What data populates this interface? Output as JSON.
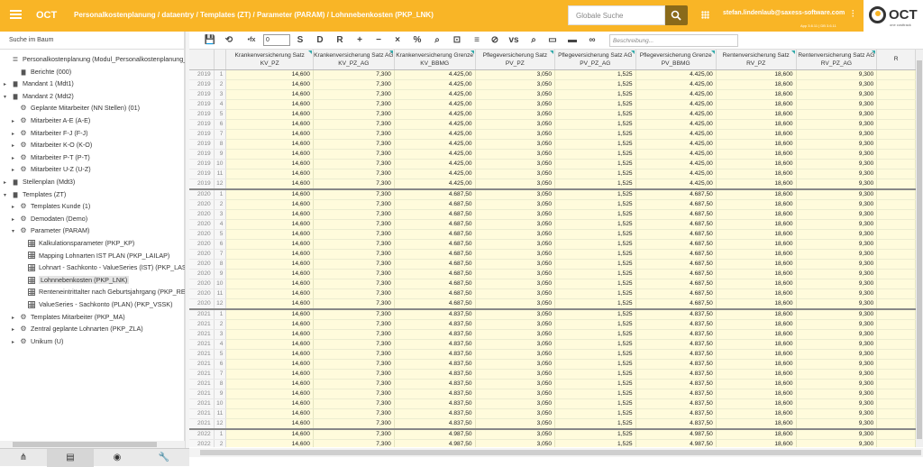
{
  "header": {
    "app_title": "OCT",
    "breadcrumb": "Personalkostenplanung / dataentry / Templates (ZT) / Parameter (PARAM) / Lohnnebenkosten (PKP_LNK)",
    "search_placeholder": "Globale Suche",
    "user": "stefan.lindenlaub@saxess-software.com",
    "version": "App 3.6.11 | DB 3.6.11",
    "logo_text": "OCT",
    "logo_sub": "one costtrack",
    "accent": "#f9b526"
  },
  "sidebar": {
    "search_label": "Suche im Baum",
    "items": [
      {
        "label": "Personalkostenplanung (Modul_Personalkostenplanung_De",
        "indent": 0,
        "arrow": "",
        "icon": "db"
      },
      {
        "label": "Berichte (000)",
        "indent": 1,
        "arrow": "",
        "icon": "folder"
      },
      {
        "label": "Mandant 1 (Mdt1)",
        "indent": 0,
        "arrow": "▸",
        "icon": "folder"
      },
      {
        "label": "Mandant 2 (Mdt2)",
        "indent": 0,
        "arrow": "▾",
        "icon": "folder"
      },
      {
        "label": "Geplante Mitarbeiter (NN Stellen) (01)",
        "indent": 1,
        "arrow": "",
        "icon": "gear"
      },
      {
        "label": "Mitarbeiter A-E (A-E)",
        "indent": 1,
        "arrow": "▸",
        "icon": "gear"
      },
      {
        "label": "Mitarbeiter F-J (F-J)",
        "indent": 1,
        "arrow": "▸",
        "icon": "gear"
      },
      {
        "label": "Mitarbeiter K-O (K-O)",
        "indent": 1,
        "arrow": "▸",
        "icon": "gear"
      },
      {
        "label": "Mitarbeiter P-T (P-T)",
        "indent": 1,
        "arrow": "▸",
        "icon": "gear"
      },
      {
        "label": "Mitarbeiter U-Z (U-Z)",
        "indent": 1,
        "arrow": "▸",
        "icon": "gear"
      },
      {
        "label": "Stellenplan (Mdt3)",
        "indent": 0,
        "arrow": "▸",
        "icon": "folder"
      },
      {
        "label": "Templates (ZT)",
        "indent": 0,
        "arrow": "▾",
        "icon": "folder"
      },
      {
        "label": "Templates Kunde (1)",
        "indent": 1,
        "arrow": "▸",
        "icon": "gear"
      },
      {
        "label": "Demodaten (Demo)",
        "indent": 1,
        "arrow": "▸",
        "icon": "gear"
      },
      {
        "label": "Parameter (PARAM)",
        "indent": 1,
        "arrow": "▾",
        "icon": "gear"
      },
      {
        "label": "Kalkulationsparameter (PKP_KP)",
        "indent": 2,
        "arrow": "",
        "icon": "table"
      },
      {
        "label": "Mapping Lohnarten IST PLAN (PKP_LAILAP)",
        "indent": 2,
        "arrow": "",
        "icon": "table"
      },
      {
        "label": "Lohnart - Sachkonto - ValueSeries (IST) (PKP_LASK",
        "indent": 2,
        "arrow": "",
        "icon": "table"
      },
      {
        "label": "Lohnnebenkosten (PKP_LNK)",
        "indent": 2,
        "arrow": "",
        "icon": "table",
        "selected": true
      },
      {
        "label": "Renteneintrittalter nach Geburtsjahrgang (PKP_REN",
        "indent": 2,
        "arrow": "",
        "icon": "table"
      },
      {
        "label": "ValueSeries - Sachkonto (PLAN) (PKP_VSSK)",
        "indent": 2,
        "arrow": "",
        "icon": "table"
      },
      {
        "label": "Templates Mitarbeiter (PKP_MA)",
        "indent": 1,
        "arrow": "▸",
        "icon": "gear"
      },
      {
        "label": "Zentral geplante Lohnarten (PKP_ZLA)",
        "indent": 1,
        "arrow": "▸",
        "icon": "gear"
      },
      {
        "label": "Unikum (U)",
        "indent": 1,
        "arrow": "▸",
        "icon": "gear"
      }
    ]
  },
  "bottom_tabs": [
    {
      "icon": "tree-icon",
      "glyph": "⋔"
    },
    {
      "icon": "table-icon",
      "glyph": "▤"
    },
    {
      "icon": "eye-icon",
      "glyph": "◉"
    },
    {
      "icon": "wrench-icon",
      "glyph": "🔧"
    }
  ],
  "toolbar": {
    "input_value": "0",
    "description_placeholder": "Beschreibung...",
    "buttons": [
      {
        "name": "save-icon",
        "glyph": "💾"
      },
      {
        "name": "history-icon",
        "glyph": "⟲"
      },
      {
        "name": "formula-icon",
        "glyph": "•fx"
      },
      {
        "name": "s-button",
        "glyph": "S"
      },
      {
        "name": "d-button",
        "glyph": "D"
      },
      {
        "name": "r-button",
        "glyph": "R"
      },
      {
        "name": "plus-icon",
        "glyph": "+"
      },
      {
        "name": "minus-icon",
        "glyph": "−"
      },
      {
        "name": "times-icon",
        "glyph": "×"
      },
      {
        "name": "percent-icon",
        "glyph": "%"
      },
      {
        "name": "search-icon",
        "glyph": "⌕"
      },
      {
        "name": "zoom-icon",
        "glyph": "⊡"
      },
      {
        "name": "filter-icon",
        "glyph": "≡"
      },
      {
        "name": "link-icon",
        "glyph": "⊘"
      },
      {
        "name": "version-icon",
        "glyph": "vs"
      },
      {
        "name": "find-icon",
        "glyph": "⌕"
      },
      {
        "name": "doc-icon",
        "glyph": "▭"
      },
      {
        "name": "comment-icon",
        "glyph": "▬"
      },
      {
        "name": "chain-icon",
        "glyph": "∞"
      }
    ]
  },
  "table": {
    "columns": [
      "",
      "",
      "Krankenversicherung Satz\nKV_PZ",
      "Krankenversicherung Satz AG\nKV_PZ_AG",
      "Krankenversicherung Grenze\nKV_BBMG",
      "Pflegeversicherung Satz\nPV_PZ",
      "Pflegeversicherung Satz AG\nPV_PZ_AG",
      "Pflegeversicherung Grenze\nPV_BBMG",
      "Rentenversicherung Satz\nRV_PZ",
      "Rentenversicherung Satz AG\nRV_PZ_AG",
      "R"
    ],
    "years": [
      {
        "year": "2019",
        "months": 12,
        "values": [
          "14,600",
          "7,300",
          "4.425,00",
          "3,050",
          "1,525",
          "4.425,00",
          "18,600",
          "9,300"
        ]
      },
      {
        "year": "2020",
        "months": 12,
        "values": [
          "14,600",
          "7,300",
          "4.687,50",
          "3,050",
          "1,525",
          "4.687,50",
          "18,600",
          "9,300"
        ]
      },
      {
        "year": "2021",
        "months": 12,
        "values": [
          "14,600",
          "7,300",
          "4.837,50",
          "3,050",
          "1,525",
          "4.837,50",
          "18,600",
          "9,300"
        ]
      },
      {
        "year": "2022",
        "months": 3,
        "values": [
          "14,600",
          "7,300",
          "4.987,50",
          "3,050",
          "1,525",
          "4.987,50",
          "18,600",
          "9,300"
        ]
      }
    ]
  }
}
